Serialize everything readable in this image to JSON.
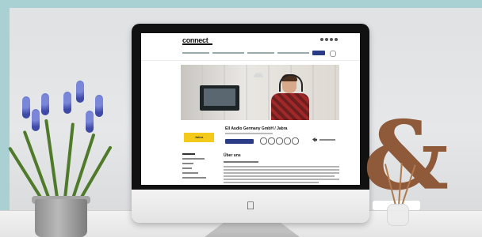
{
  "screen": {
    "logo_text": "connect",
    "company_name": "Ell Audio Germany GmbH / Jabra",
    "partner_badge": "Jabra",
    "about_title": "Über uns"
  },
  "colors": {
    "brand_blue": "#2a3c85",
    "badge_yellow": "#f3c91a",
    "wall": "#e2e3e5",
    "teal": "#a9d1d3",
    "wood": "#8e5a3a"
  },
  "icons": [
    "apple-logo-icon",
    "share-icon"
  ]
}
